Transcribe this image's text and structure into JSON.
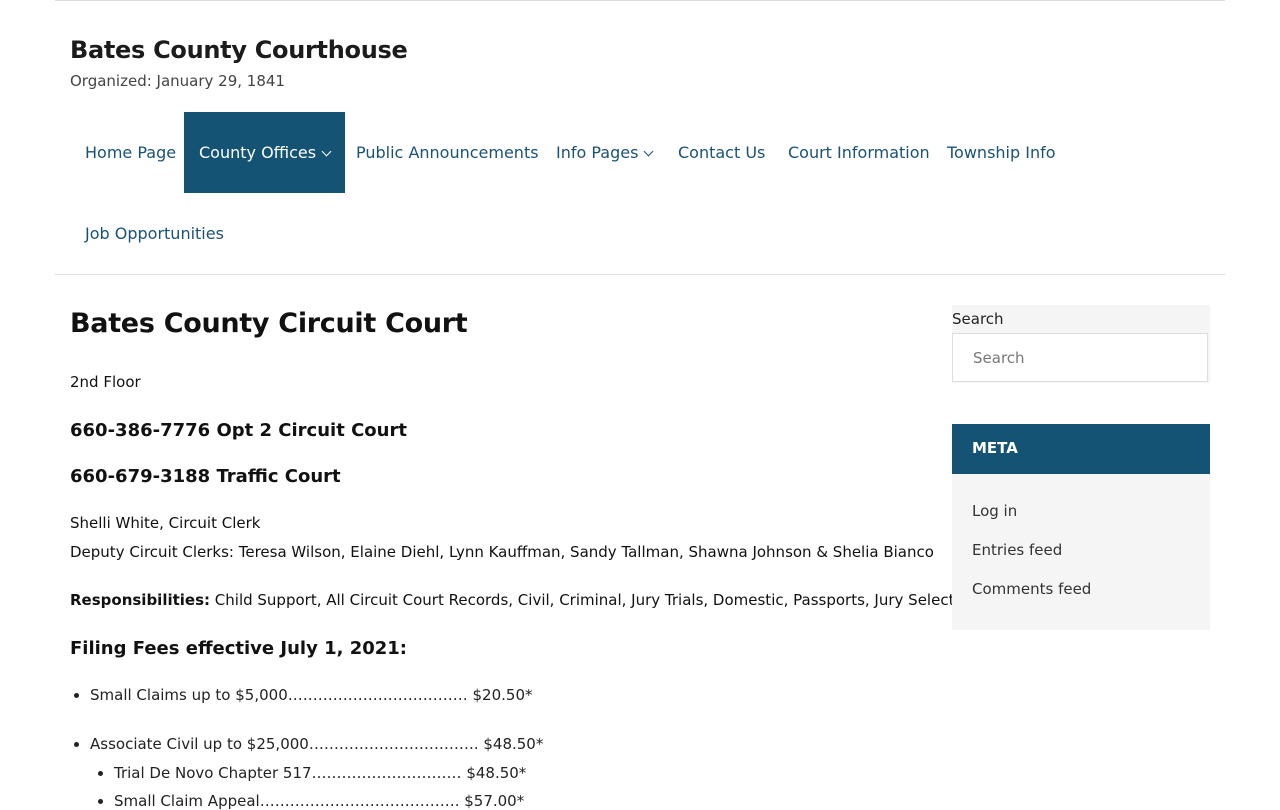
{
  "site": {
    "title": "Bates County Courthouse",
    "description": "Organized: January 29, 1841"
  },
  "nav": {
    "items": [
      {
        "label": "Home Page",
        "has_submenu": false,
        "active": false
      },
      {
        "label": "County Offices",
        "has_submenu": true,
        "active": true
      },
      {
        "label": "Public Announcements",
        "has_submenu": false,
        "active": false
      },
      {
        "label": "Info Pages",
        "has_submenu": true,
        "active": false
      },
      {
        "label": "Contact Us",
        "has_submenu": false,
        "active": false
      },
      {
        "label": "Court Information",
        "has_submenu": false,
        "active": false
      },
      {
        "label": "Township Info",
        "has_submenu": false,
        "active": false
      },
      {
        "label": "Job Opportunities",
        "has_submenu": false,
        "active": false
      }
    ]
  },
  "content": {
    "title": "Bates County Circuit Court",
    "floor": "2nd Floor",
    "phone1": "660-386-7776 Opt 2 Circuit Court",
    "phone2": "660-679-3188 Traffic Court",
    "clerk": "Shelli White, Circuit Clerk",
    "deputies": "Deputy Circuit Clerks: Teresa Wilson, Elaine Diehl, Lynn Kauffman, Sandy Tallman, Shawna Johnson & Shelia Bianco",
    "responsibilities_label": "Responsibilities:",
    "responsibilities_text": " Child Support, All Circuit Court Records, Civil, Criminal, Jury Trials, Domestic, Passports, Jury Selection",
    "fees_heading": "Filing Fees effective July 1, 2021:",
    "fees": [
      {
        "text": "Small Claims up to $5,000……………………………… $20.50*"
      },
      {
        "text": "Associate Civil up to $25,000……………………………. $48.50*"
      },
      {
        "text": "Trial De Novo Chapter 517………………………… $48.50*",
        "sub": true
      },
      {
        "text": "Small Claim Appeal…………………………………. $57.00*",
        "sub": true
      }
    ]
  },
  "sidebar": {
    "search_label": "Search",
    "search_placeholder": "Search",
    "meta_title": "META",
    "meta_links": [
      "Log in",
      "Entries feed",
      "Comments feed"
    ]
  },
  "colors": {
    "accent": "#145374",
    "link": "#1a5276"
  }
}
